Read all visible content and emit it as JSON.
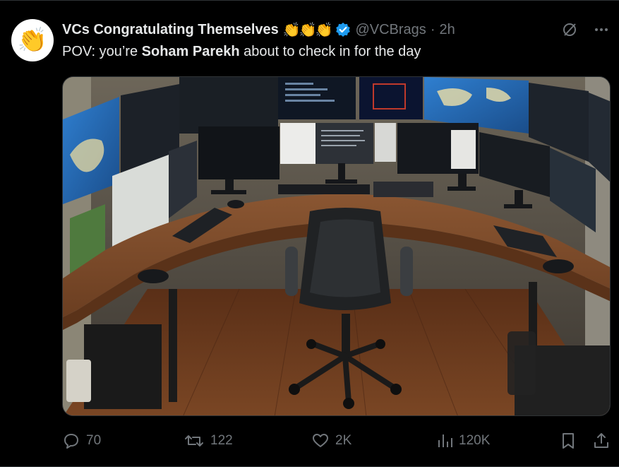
{
  "tweet": {
    "avatar_emoji": "👏",
    "display_name": "VCs Congratulating Themselves",
    "name_emojis": "👏👏👏",
    "handle": "@VCBrags",
    "separator": "·",
    "time": "2h",
    "text_before": "POV: you’re ",
    "text_bold": "Soham Parekh",
    "text_after": " about to check in for the day",
    "media_description_icon": "photo-of-multi-monitor-desk-setup"
  },
  "actions": {
    "replies": "70",
    "reposts": "122",
    "likes": "2K",
    "views": "120K"
  },
  "colors": {
    "background": "#000000",
    "text": "#e7e9ea",
    "muted": "#71767b",
    "verified": "#1d9bf0",
    "border": "#2f3336"
  }
}
